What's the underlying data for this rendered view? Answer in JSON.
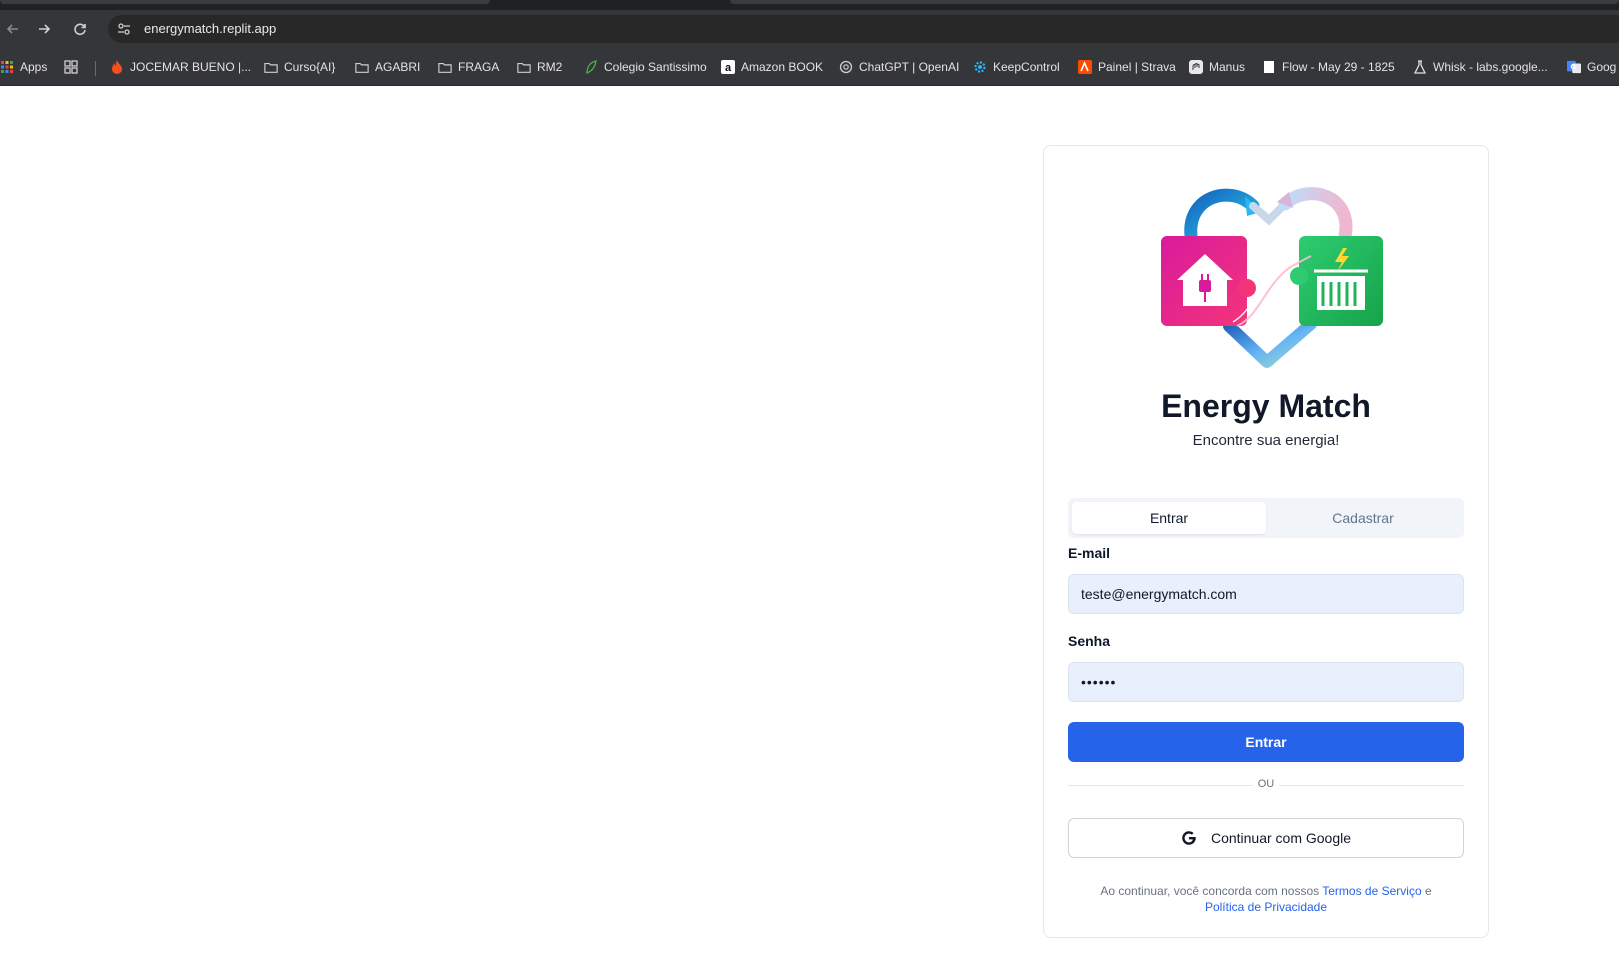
{
  "browser": {
    "url": "energymatch.replit.app",
    "bookmarks": [
      {
        "label": "Apps",
        "icon": "apps-grid-icon"
      },
      {
        "label": "",
        "icon": "tab-groups-icon"
      },
      {
        "label": "JOCEMAR BUENO |...",
        "icon": "flame-icon"
      },
      {
        "label": "Curso{AI}",
        "icon": "folder-icon"
      },
      {
        "label": "AGABRI",
        "icon": "folder-icon"
      },
      {
        "label": "FRAGA",
        "icon": "folder-icon"
      },
      {
        "label": "RM2",
        "icon": "folder-icon"
      },
      {
        "label": "Colegio Santissimo",
        "icon": "leaf-icon"
      },
      {
        "label": "Amazon BOOK",
        "icon": "amazon-icon"
      },
      {
        "label": "ChatGPT | OpenAI",
        "icon": "openai-icon"
      },
      {
        "label": "KeepControl",
        "icon": "gear-icon"
      },
      {
        "label": "Painel | Strava",
        "icon": "strava-icon"
      },
      {
        "label": "Manus",
        "icon": "manus-icon"
      },
      {
        "label": "Flow - May 29 - 1825",
        "icon": "page-icon"
      },
      {
        "label": "Whisk - labs.google...",
        "icon": "flask-icon"
      },
      {
        "label": "Goog",
        "icon": "google-translate-icon"
      }
    ]
  },
  "brand": {
    "title": "Energy Match",
    "subtitle": "Encontre sua energia!"
  },
  "tabs": {
    "login": "Entrar",
    "signup": "Cadastrar",
    "active": "login"
  },
  "form": {
    "email_label": "E-mail",
    "email_value": "teste@energymatch.com",
    "password_label": "Senha",
    "password_value": "••••••",
    "submit_label": "Entrar"
  },
  "divider": {
    "text": "OU"
  },
  "google": {
    "label": "Continuar com Google"
  },
  "legal": {
    "prefix": "Ao continuar, você concorda com nossos",
    "terms": "Termos de Serviço",
    "and": "e",
    "privacy": "Política de Privacidade"
  },
  "colors": {
    "primary": "#2563eb",
    "input_bg": "#e8f0fe",
    "house_piece": "#e11d8c",
    "dam_piece": "#22b35a",
    "heart_blue": "#1e88e5",
    "heart_pink": "#e6a4c4"
  }
}
